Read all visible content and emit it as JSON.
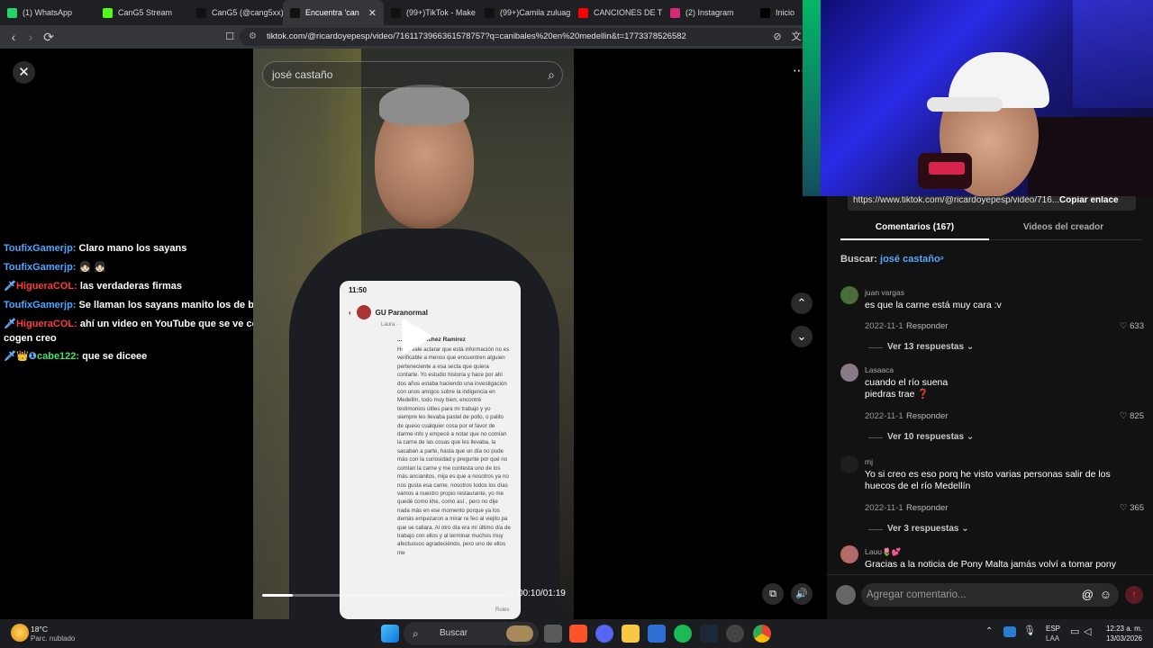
{
  "browser": {
    "tabs": [
      {
        "label": "(1) WhatsApp",
        "icon": "whatsapp-icon",
        "color": "#25d366"
      },
      {
        "label": "CanG5 Stream",
        "icon": "kick-icon",
        "color": "#53fc18"
      },
      {
        "label": "CanG5 (@cang5xx)",
        "icon": "tiktok-icon",
        "color": "#111111"
      },
      {
        "label": "Encuentra 'can",
        "icon": "tiktok-icon",
        "color": "#111111",
        "active": true
      },
      {
        "label": "(99+)TikTok - Make",
        "icon": "tiktok-icon",
        "color": "#111111"
      },
      {
        "label": "(99+)Camila zuluag",
        "icon": "tiktok-icon",
        "color": "#111111"
      },
      {
        "label": "CANCIONES DE TER",
        "icon": "youtube-icon",
        "color": "#ff0000"
      },
      {
        "label": "(2) Instagram",
        "icon": "instagram-icon",
        "color": "#d62976"
      },
      {
        "label": "Inicio / X",
        "icon": "x-icon",
        "color": "#000000"
      }
    ],
    "url": "tiktok.com/@ricardoyepesp/video/7161173966361578757?q=canibales%20en%20medellin&t=1773378526582"
  },
  "video": {
    "search_value": "josé castaño",
    "time": "00:10/01:19",
    "progress": 0.126,
    "phone": {
      "status_time": "11:50",
      "account": "GU Paranormal",
      "account_sub": "Laura · ·  1h · ",
      "commenter": "...anda Sanchez Ramirez",
      "text": "Hola, vale aclarar que está información no es verificable a menos que encuentren alguien perteneciente a esa secta que quiera contarte. Yo estudio historia y hace por ahí dos años estaba haciendo una investigación con unos amigos sobre la indigencia en Medellín, todo muy bien, encontré testimonios útiles para mi trabajo y yo siempre les llevaba pastel de pollo, o palito de queso cualquier cosa por el favor de darme info y empecé a notar que no comían la carne de las cosas que les llevaba, la sacaban a parte, hasta que un día no pude más con la curiosidad y pregunte por qué no comían la carne y me contesta uno de los más ancianitos, mija es que a nosotros ya no nos gusta esa carne, nosotros todos los días vamos a nuestro propio restaurante, yo me quedé como khe, como así , pero no dije nada más en ese momento porque ya los demás empezaron a mirar re feo al viejito pa que se callara. Al otro día era mi último día de trabajo con ellos y al terminar muchos muy afectuosos agradeciéndo, pero uno de ellos me",
      "footer": "Rules"
    }
  },
  "chat": [
    {
      "user": "ToufixGamerjp:",
      "user_color": "#4ea7ff",
      "badge": "",
      "message": "Claro mano los sayans"
    },
    {
      "user": "ToufixGamerjp:",
      "user_color": "#4ea7ff",
      "badge": "",
      "message": "👧🏻 👧🏻"
    },
    {
      "user": "HigueraCOL:",
      "user_color": "#ff3b3b",
      "badge": "🗡",
      "message": "las verdaderas firmas"
    },
    {
      "user": "ToufixGamerjp:",
      "user_color": "#4ea7ff",
      "badge": "",
      "message": "Se llaman los sayans manito los de bogota"
    },
    {
      "user": "HigueraCOL:",
      "user_color": "#ff3b3b",
      "badge": "🗡",
      "message": "ahí un video en YouTube que se ve como los cogen creo"
    },
    {
      "user": "cabe122:",
      "user_color": "#3ee86a",
      "badge": "🗡👑❶",
      "message": "que se diceee"
    }
  ],
  "panel": {
    "link": "https://www.tiktok.com/@ricardoyepesp/video/716...",
    "copy_label": "Copiar enlace",
    "tab_comments": "Comentarios (167)",
    "tab_videos": "Videos del creador",
    "search_prefix": "Buscar:",
    "search_term": "josé castaño",
    "comments": [
      {
        "user": "juan vargas",
        "text": "es que la carne está muy cara :v",
        "date": "2022-11-1",
        "reply": "Responder",
        "likes": "633",
        "replies": "Ver 13 respuestas",
        "avatar_color": "#4a6b3a"
      },
      {
        "user": "Lasaaca",
        "text": "cuando el río suena piedras trae ❓",
        "date": "2022-11-1",
        "reply": "Responder",
        "likes": "825",
        "replies": "Ver 10 respuestas",
        "avatar_color": "#8a7a86"
      },
      {
        "user": "mj",
        "text": "Yo si creo es eso porq he visto varias personas salir de los huecos de el río Medellín",
        "date": "2022-11-1",
        "reply": "Responder",
        "likes": "365",
        "replies": "Ver 3 respuestas",
        "avatar_color": "#1e1e1e"
      },
      {
        "user": "Laʊʊ🌷💕",
        "text": "Gracias a la noticia de Pony Malta jamás volví a tomar pony",
        "date": "",
        "reply": "",
        "likes": "",
        "replies": "",
        "avatar_color": "#b56a6a"
      }
    ],
    "add_comment_placeholder": "Agregar comentario..."
  },
  "taskbar": {
    "weather_temp": "18°C",
    "weather_desc": "Parc. nublado",
    "search_label": "Buscar",
    "lang": "ESP",
    "lang_sub": "LAA",
    "time": "12:23 a. m.",
    "date": "13/03/2026"
  }
}
